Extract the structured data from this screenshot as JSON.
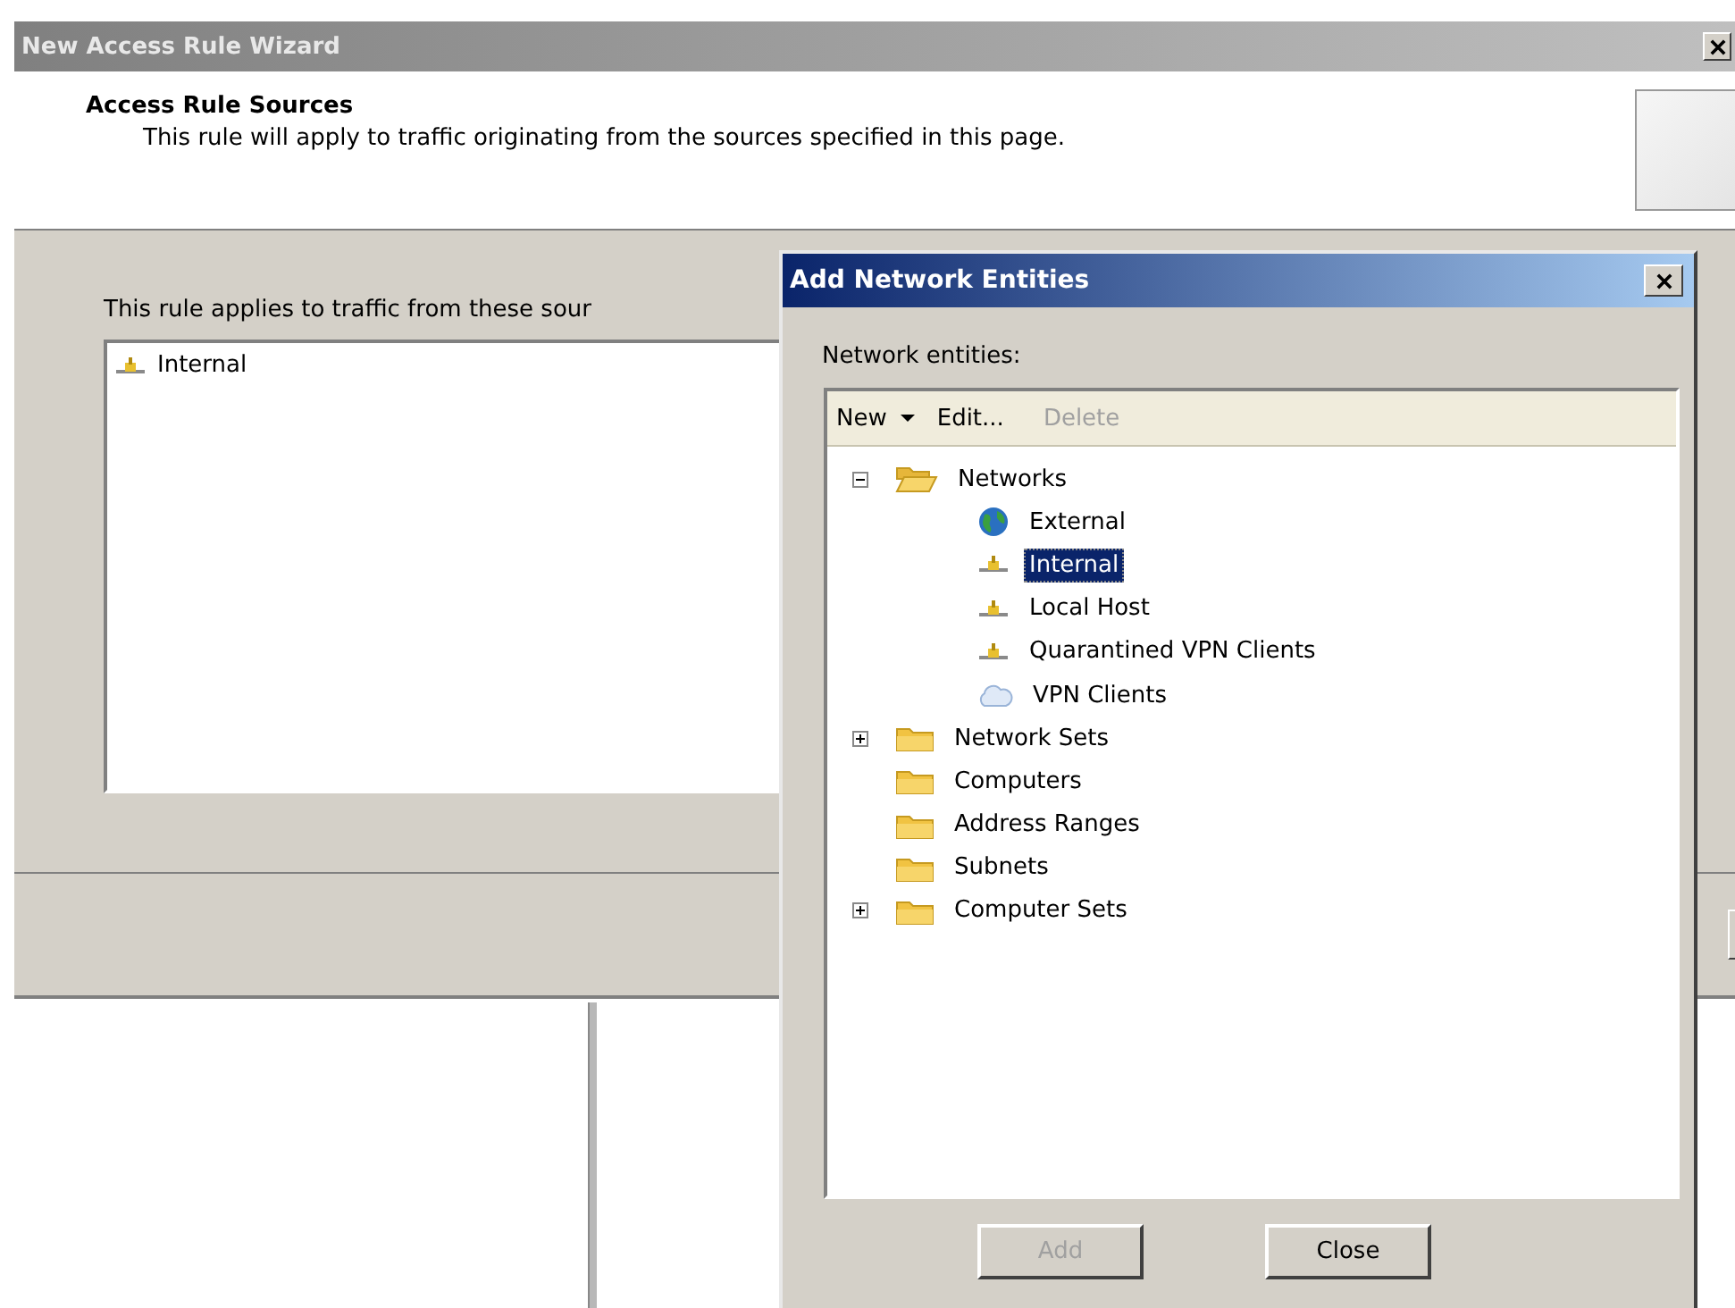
{
  "wizard": {
    "title": "New Access Rule Wizard",
    "heading": "Access Rule Sources",
    "description": "This rule will apply to traffic originating from the sources specified in this page.",
    "prompt": "This rule applies to traffic from these sour",
    "sources": [
      {
        "label": "Internal",
        "kind": "network"
      }
    ]
  },
  "dialog": {
    "title": "Add Network Entities",
    "label": "Network entities:",
    "toolbar": [
      {
        "label": "New",
        "dropdown": true,
        "disabled": false
      },
      {
        "label": "Edit...",
        "dropdown": false,
        "disabled": false
      },
      {
        "label": "Delete",
        "dropdown": false,
        "disabled": true
      }
    ],
    "tree": [
      {
        "label": "Networks",
        "kind": "open-folder",
        "expanded": true,
        "selected": false,
        "children": [
          {
            "label": "External",
            "kind": "globe",
            "selected": false
          },
          {
            "label": "Internal",
            "kind": "network",
            "selected": true
          },
          {
            "label": "Local Host",
            "kind": "network",
            "selected": false
          },
          {
            "label": "Quarantined VPN Clients",
            "kind": "network",
            "selected": false
          },
          {
            "label": "VPN Clients",
            "kind": "cloud",
            "selected": false
          }
        ]
      },
      {
        "label": "Network Sets",
        "kind": "folder",
        "expanded": false,
        "selected": false
      },
      {
        "label": "Computers",
        "kind": "folder",
        "selected": false
      },
      {
        "label": "Address Ranges",
        "kind": "folder",
        "selected": false
      },
      {
        "label": "Subnets",
        "kind": "folder",
        "selected": false
      },
      {
        "label": "Computer Sets",
        "kind": "folder",
        "expanded": false,
        "selected": false
      }
    ],
    "buttons": [
      {
        "label": "Add",
        "disabled": true
      },
      {
        "label": "Close",
        "disabled": false
      }
    ]
  }
}
